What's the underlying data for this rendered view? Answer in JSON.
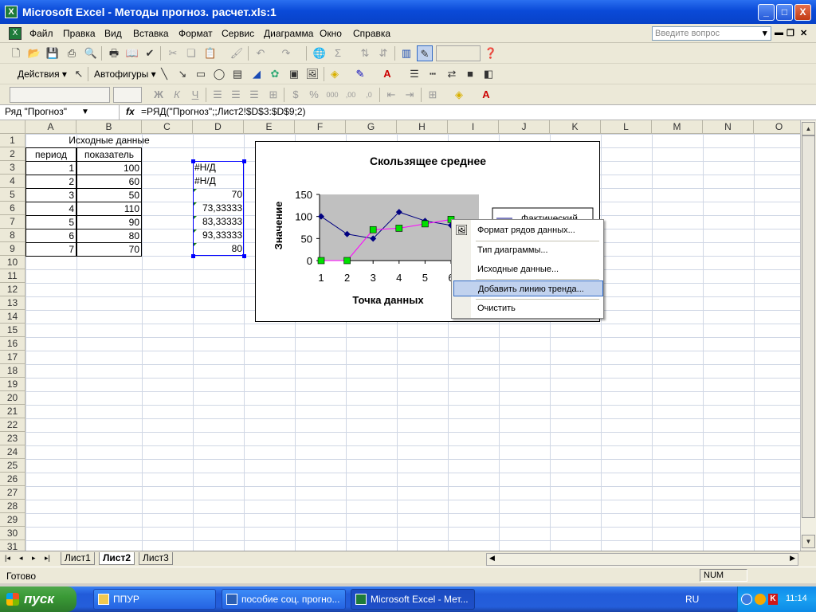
{
  "window": {
    "title": "Microsoft Excel - Методы прогноз. расчет.xls:1",
    "app_icon": "X",
    "min_glyph": "_",
    "max_glyph": "□",
    "close_glyph": "X"
  },
  "menu": {
    "items": [
      "Файл",
      "Правка",
      "Вид",
      "Вставка",
      "Формат",
      "Сервис",
      "Диаграмма",
      "Окно",
      "Справка"
    ],
    "ask_placeholder": "Введите вопрос",
    "mdi_min": "▾",
    "mdi_restore": "▬",
    "mdi_restore2": "❐",
    "mdi_close": "✕"
  },
  "drawing_toolbar": {
    "actions_label": "Действия ▾",
    "autoshapes_label": "Автофигуры ▾"
  },
  "formula_bar": {
    "name_box": "Ряд \"Прогноз\"",
    "fx": "fx",
    "formula": "=РЯД(\"Прогноз\";;Лист2!$D$3:$D$9;2)"
  },
  "sheet": {
    "columns": [
      "A",
      "B",
      "C",
      "D",
      "E",
      "F",
      "G",
      "H",
      "I",
      "J",
      "K",
      "L",
      "M",
      "N",
      "O"
    ],
    "rows": [
      "1",
      "2",
      "3",
      "4",
      "5",
      "6",
      "7",
      "8",
      "9",
      "10",
      "11",
      "12",
      "13",
      "14",
      "15",
      "16",
      "17",
      "18",
      "19",
      "20",
      "21",
      "22",
      "23",
      "24",
      "25",
      "26",
      "27",
      "28",
      "29",
      "30",
      "31"
    ],
    "title_cell": "Исходные данные",
    "header_a": "период",
    "header_b": "показатель",
    "col_a": [
      "1",
      "2",
      "3",
      "4",
      "5",
      "6",
      "7"
    ],
    "col_b": [
      "100",
      "60",
      "50",
      "110",
      "90",
      "80",
      "70"
    ],
    "col_d": [
      "#Н/Д",
      "#Н/Д",
      "70",
      "73,33333",
      "83,33333",
      "93,33333",
      "80"
    ]
  },
  "chart": {
    "title": "Скользящее среднее",
    "ylabel": "Значение",
    "xlabel": "Точка данных",
    "legend_visible": "Фактический"
  },
  "chart_data": {
    "type": "line",
    "title": "Скользящее среднее",
    "xlabel": "Точка данных",
    "ylabel": "Значение",
    "x": [
      1,
      2,
      3,
      4,
      5,
      6,
      7
    ],
    "ylim": [
      0,
      150
    ],
    "yticks": [
      0,
      50,
      100,
      150
    ],
    "series": [
      {
        "name": "Фактический",
        "values": [
          100,
          60,
          50,
          110,
          90,
          80,
          70
        ],
        "color": "#000080"
      },
      {
        "values": [
          0,
          0,
          70,
          73.33333,
          83.33333,
          93.33333,
          80
        ],
        "color": "#ff00ff"
      }
    ],
    "grid": false,
    "plot_background": "#c0c0c0",
    "legend": "right"
  },
  "context_menu": {
    "items": [
      "Формат рядов данных...",
      "Тип диаграммы...",
      "Исходные данные...",
      "Добавить линию тренда...",
      "Очистить"
    ],
    "highlighted_index": 3
  },
  "tabs": {
    "nav": [
      "|◂",
      "◂",
      "▸",
      "▸|"
    ],
    "sheets": [
      "Лист1",
      "Лист2",
      "Лист3"
    ],
    "active": "Лист2"
  },
  "status": {
    "ready": "Готово",
    "num": "NUM"
  },
  "taskbar": {
    "start": "пуск",
    "tasks": [
      "ППУР",
      "пособие соц. прогно...",
      "Microsoft Excel - Мет..."
    ],
    "lang": "RU",
    "clock": "11:14"
  }
}
